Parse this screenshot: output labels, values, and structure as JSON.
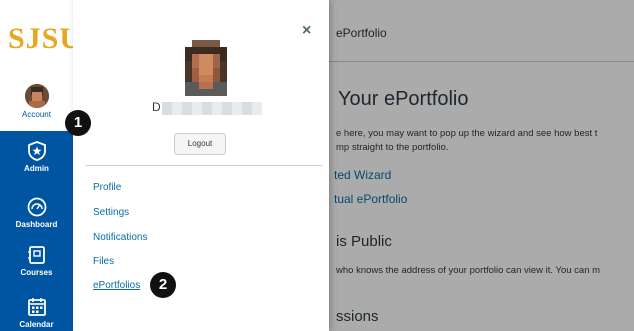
{
  "sidebar": {
    "logo": "SJSU",
    "items": [
      {
        "label": "Account",
        "icon": "account-avatar"
      },
      {
        "label": "Admin",
        "icon": "shield-star-icon"
      },
      {
        "label": "Dashboard",
        "icon": "dashboard-gauge-icon"
      },
      {
        "label": "Courses",
        "icon": "courses-book-icon"
      },
      {
        "label": "Calendar",
        "icon": "calendar-icon"
      }
    ],
    "accent": "#0055a2",
    "logo_color": "#e5a823"
  },
  "tray": {
    "close_label": "×",
    "name_initial": "D",
    "logout_label": "Logout",
    "links": [
      "Profile",
      "Settings",
      "Notifications",
      "Files",
      "ePortfolios"
    ]
  },
  "badges": {
    "step1": "1",
    "step2": "2"
  },
  "background_page": {
    "header_title": "ePortfolio",
    "heading": "Your ePortfolio",
    "intro_line1": "e here, you may want to pop up the wizard and see how best t",
    "intro_line2": "mp straight to the portfolio.",
    "link1": "ted Wizard",
    "link2": "tual ePortfolio",
    "section1": "is Public",
    "section1_text": "who knows the address of your portfolio can view it. You can m",
    "section2": "ssions"
  }
}
